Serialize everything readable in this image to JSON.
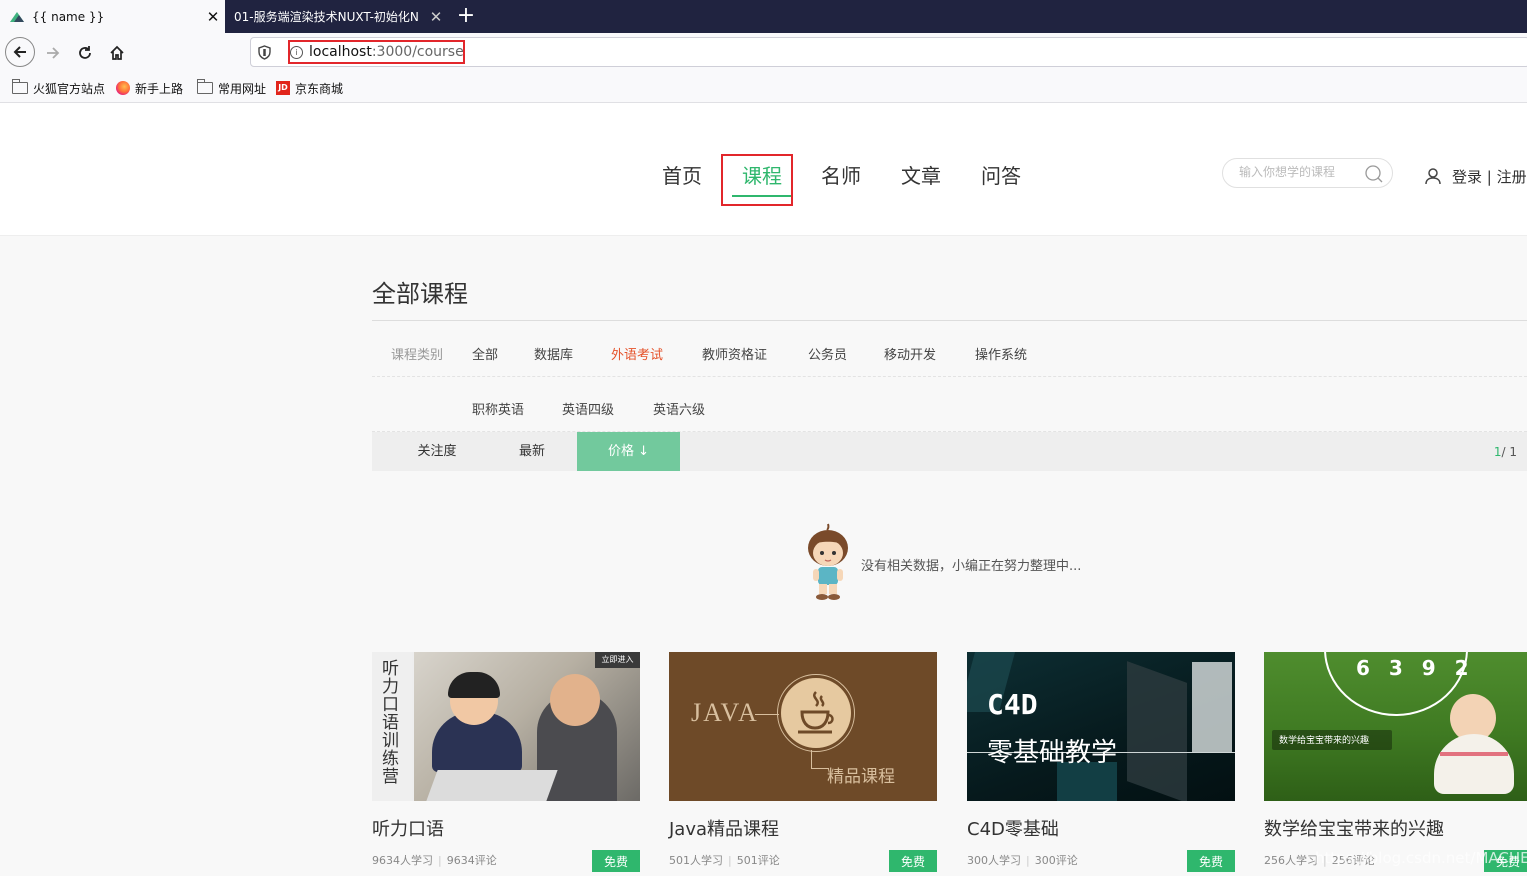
{
  "browser": {
    "tabs": [
      {
        "title": "{{ name }}",
        "active": true
      },
      {
        "title": "01-服务端渲染技术NUXT-初始化N",
        "active": false
      }
    ],
    "url_host": "localhost",
    "url_path": ":3000/course",
    "bookmarks": [
      "火狐官方站点",
      "新手上路",
      "常用网址",
      "京东商城"
    ]
  },
  "header": {
    "nav": [
      "首页",
      "课程",
      "名师",
      "文章",
      "问答"
    ],
    "active_nav": "课程",
    "search_placeholder": "输入你想学的课程",
    "login_text": "登录 | 注册"
  },
  "main": {
    "title": "全部课程",
    "category_label": "课程类别",
    "categories": [
      "全部",
      "数据库",
      "外语考试",
      "教师资格证",
      "公务员",
      "移动开发",
      "操作系统"
    ],
    "active_category": "外语考试",
    "subcategories": [
      "职称英语",
      "英语四级",
      "英语六级"
    ],
    "sorts": [
      "关注度",
      "最新",
      "价格 ↓"
    ],
    "active_sort": "价格 ↓",
    "pager_current": "1",
    "pager_total": "/ 1",
    "empty_text": "没有相关数据，小编正在努力整理中..."
  },
  "courses": [
    {
      "title": "听力口语",
      "learners": "9634人学习",
      "comments": "9634评论",
      "badge": "免费",
      "image_text": "听力口语训练营",
      "image_corner": "立即进入"
    },
    {
      "title": "Java精品课程",
      "learners": "501人学习",
      "comments": "501评论",
      "badge": "免费",
      "image_text": "JAVA",
      "image_sub": "精品课程"
    },
    {
      "title": "C4D零基础",
      "learners": "300人学习",
      "comments": "300评论",
      "badge": "免费",
      "image_text": "C4D",
      "image_sub": "零基础教学"
    },
    {
      "title": "数学给宝宝带来的兴趣",
      "learners": "256人学习",
      "comments": "256评论",
      "badge": "免费",
      "image_text": "数学给宝宝带来的兴趣",
      "image_sub": "6 3 9 2"
    }
  ],
  "watermark": "https://blog.csdn.net/MACHENIC",
  "colors": {
    "accent_green": "#2fb76d",
    "active_category": "#e5522a",
    "highlight_red": "#e2262b",
    "tabbar": "#202340"
  }
}
